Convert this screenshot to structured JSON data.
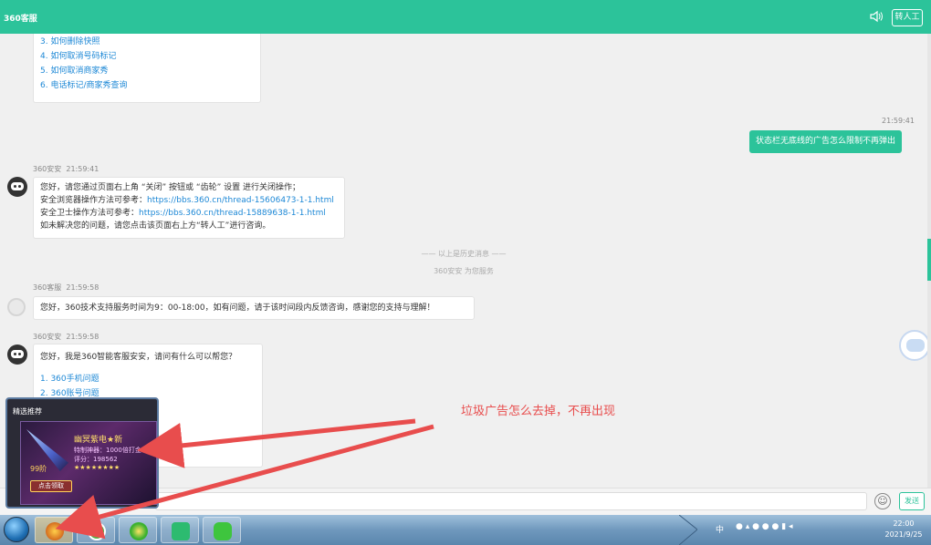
{
  "header": {
    "title": "360客服",
    "transfer_label": "转人工"
  },
  "chat": {
    "top_list": {
      "items": [
        "3. 如何删除快照",
        "4. 如何取消号码标记",
        "5. 如何取消商家秀",
        "6. 电话标记/商家秀查询"
      ]
    },
    "user_message": {
      "time": "21:59:41",
      "text": "状态栏无底线的广告怎么限制不再弹出"
    },
    "bot_msg1": {
      "sender": "360安安",
      "time": "21:59:41",
      "line1": "您好，请您通过页面右上角 “关闭” 按钮或 “齿轮” 设置 进行关闭操作；",
      "line2_prefix": "安全浏览器操作方法可参考：",
      "line2_link": "https://bbs.360.cn/thread-15606473-1-1.html",
      "line3_prefix": "安全卫士操作方法可参考：",
      "line3_link": "https://bbs.360.cn/thread-15889638-1-1.html",
      "line4": "如未解决您的问题，请您点击该页面右上方“转人工”进行咨询。"
    },
    "history_divider": "—— 以上是历史消息 ——",
    "service_note": "360安安 为您服务",
    "staff_msg": {
      "sender": "360客服",
      "time": "21:59:58",
      "text": "您好，360技术支持服务时间为9：00-18:00，如有问题，请于该时间段内反馈咨询，感谢您的支持与理解！"
    },
    "bot_msg2": {
      "sender": "360安安",
      "time": "21:59:58",
      "greeting": "您好，我是360智能客服安安，请问有什么可以帮您？",
      "items": [
        "1. 360手机问题",
        "2. 360账号问题"
      ]
    }
  },
  "annotation": "垃圾广告怎么去掉，不再出现",
  "input_bar": {
    "send_label": "发送"
  },
  "popup_ad": {
    "title": "精选推荐",
    "game_name": "幽冥紫电★新",
    "lines": [
      "特制神器：1000倍打金",
      "评分：198562",
      "★★★★★★★★"
    ],
    "level": "99阶",
    "claim_label": "点击领取"
  },
  "taskbar": {
    "tray_text": "中",
    "time": "22:00",
    "date": "2021/9/25"
  },
  "colors": {
    "accent": "#2cc39a",
    "link": "#1d88d6",
    "annotation": "#e84d4d"
  },
  "icons": [
    "speaker-icon",
    "emoji-icon",
    "start-orb-icon",
    "game-icon",
    "browser-icon",
    "guard-icon",
    "gallery-icon",
    "wechat-icon"
  ]
}
